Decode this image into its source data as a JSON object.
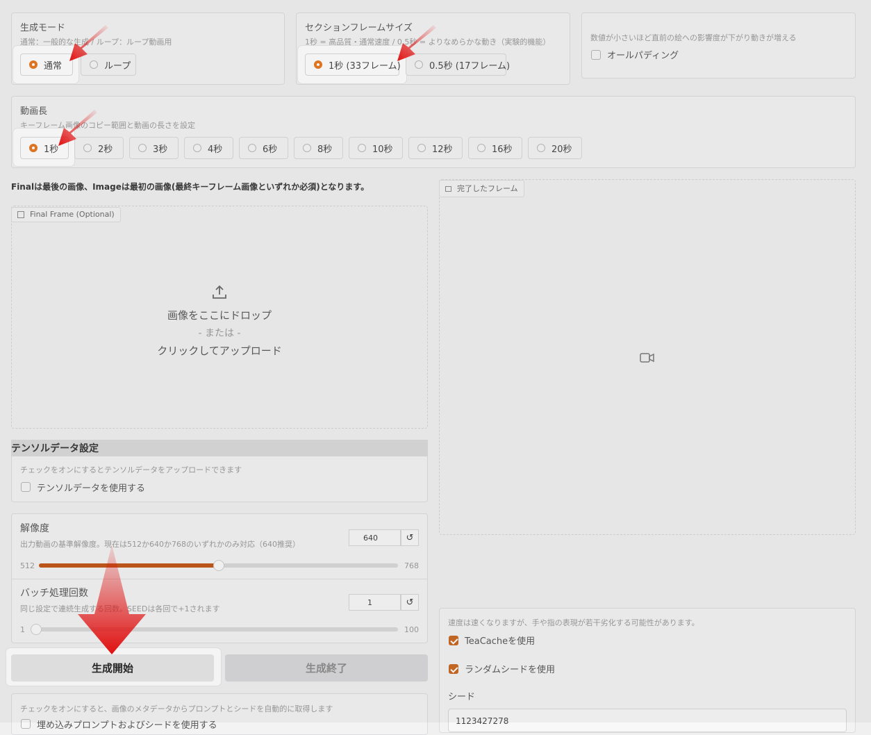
{
  "mode": {
    "label": "生成モード",
    "info": "通常：一般的な生成 / ループ：ループ動画用",
    "options": [
      "通常",
      "ループ"
    ],
    "selected": "通常"
  },
  "section_frame": {
    "label": "セクションフレームサイズ",
    "info": "1秒 = 高品質・通常速度 / 0.5秒 = よりなめらかな動き（実験的機能）",
    "options": [
      "1秒 (33フレーム)",
      "0.5秒 (17フレーム)"
    ],
    "selected": "1秒 (33フレーム)"
  },
  "all_padding": {
    "info": "数値が小さいほど直前の絵への影響度が下がり動きが増える",
    "label": "オールパディング",
    "checked": false
  },
  "video_length": {
    "label": "動画長",
    "info": "キーフレーム画像のコピー範囲と動画の長さを設定",
    "options": [
      "1秒",
      "2秒",
      "3秒",
      "4秒",
      "6秒",
      "8秒",
      "10秒",
      "12秒",
      "16秒",
      "20秒"
    ],
    "selected": "1秒"
  },
  "notice": "Finalは最後の画像、Imageは最初の画像(最終キーフレーム画像といずれか必須)となります。",
  "final_frame": {
    "tag": "Final Frame (Optional)",
    "drop_text": "画像をここにドロップ",
    "or_text": "- または -",
    "click_text": "クリックしてアップロード"
  },
  "completed_frame": {
    "tag": "完了したフレーム"
  },
  "tensor": {
    "header": "テンソルデータ設定",
    "info": "チェックをオンにするとテンソルデータをアップロードできます",
    "checkbox": "テンソルデータを使用する",
    "checked": false
  },
  "resolution": {
    "label": "解像度",
    "info": "出力動画の基準解像度。現在は512か640か768のいずれかのみ対応（640推奨）",
    "value": "640",
    "min": "512",
    "max": "768",
    "fraction": 0.5
  },
  "batch": {
    "label": "バッチ処理回数",
    "info": "同じ設定で連続生成する回数。SEEDは各回で+1されます",
    "value": "1",
    "min": "1",
    "max": "100",
    "fraction": 0.0
  },
  "buttons": {
    "start": "生成開始",
    "end": "生成終了"
  },
  "metadata": {
    "info": "チェックをオンにすると、画像のメタデータからプロンプトとシードを自動的に取得します",
    "checkbox": "埋め込みプロンプトおよびシードを使用する"
  },
  "teacache": {
    "info": "速度は速くなりますが、手や指の表現が若干劣化する可能性があります。",
    "label": "TeaCacheを使用",
    "checked": true
  },
  "random_seed": {
    "label": "ランダムシードを使用",
    "checked": true
  },
  "seed": {
    "label": "シード",
    "value": "1123427278"
  },
  "reset_icon": "↺",
  "accent": "#e8731a",
  "arrow_color": "#e01010"
}
